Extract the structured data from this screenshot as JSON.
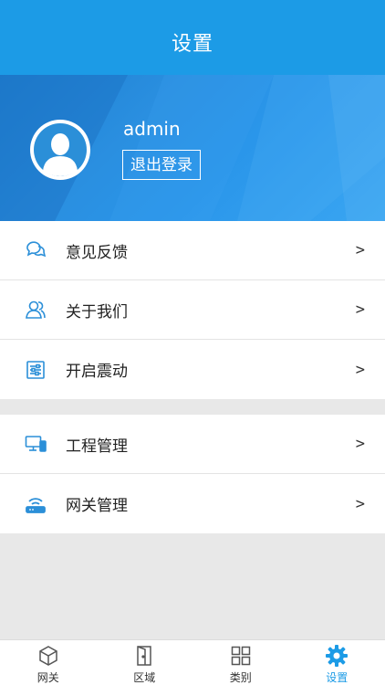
{
  "header": {
    "title": "设置"
  },
  "profile": {
    "username": "admin",
    "logout_label": "退出登录"
  },
  "menu_group_1": [
    {
      "label": "意见反馈",
      "icon": "chat-bubbles-icon",
      "chevron": ">"
    },
    {
      "label": "关于我们",
      "icon": "users-icon",
      "chevron": ">"
    },
    {
      "label": "开启震动",
      "icon": "sliders-icon",
      "chevron": ">"
    }
  ],
  "menu_group_2": [
    {
      "label": "工程管理",
      "icon": "devices-icon",
      "chevron": ">"
    },
    {
      "label": "网关管理",
      "icon": "router-icon",
      "chevron": ">"
    }
  ],
  "tabs": [
    {
      "label": "网关",
      "icon": "cube-icon",
      "active": false
    },
    {
      "label": "区域",
      "icon": "door-icon",
      "active": false
    },
    {
      "label": "类别",
      "icon": "grid-icon",
      "active": false
    },
    {
      "label": "设置",
      "icon": "gear-icon",
      "active": true
    }
  ],
  "colors": {
    "primary": "#1c9be6",
    "icon_blue": "#2b8fd8",
    "background": "#e8e8e8"
  }
}
